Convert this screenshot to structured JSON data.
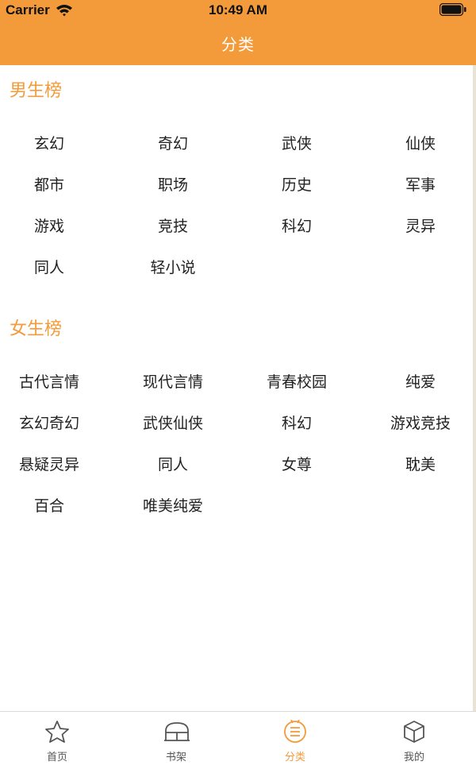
{
  "status": {
    "carrier": "Carrier",
    "time": "10:49 AM"
  },
  "nav": {
    "title": "分类"
  },
  "sections": [
    {
      "title": "男生榜",
      "items": [
        "玄幻",
        "奇幻",
        "武侠",
        "仙侠",
        "都市",
        "职场",
        "历史",
        "军事",
        "游戏",
        "竞技",
        "科幻",
        "灵异",
        "同人",
        "轻小说"
      ]
    },
    {
      "title": "女生榜",
      "items": [
        "古代言情",
        "现代言情",
        "青春校园",
        "纯爱",
        "玄幻奇幻",
        "武侠仙侠",
        "科幻",
        "游戏竞技",
        "悬疑灵异",
        "同人",
        "女尊",
        "耽美",
        "百合",
        "唯美纯爱"
      ]
    }
  ],
  "tabs": [
    {
      "label": "首页",
      "icon": "star-icon",
      "active": false
    },
    {
      "label": "书架",
      "icon": "bookshelf-icon",
      "active": false
    },
    {
      "label": "分类",
      "icon": "category-icon",
      "active": true
    },
    {
      "label": "我的",
      "icon": "box-icon",
      "active": false
    }
  ],
  "colors": {
    "accent": "#f39b3a",
    "text": "#222222",
    "tab_inactive": "#555555"
  }
}
